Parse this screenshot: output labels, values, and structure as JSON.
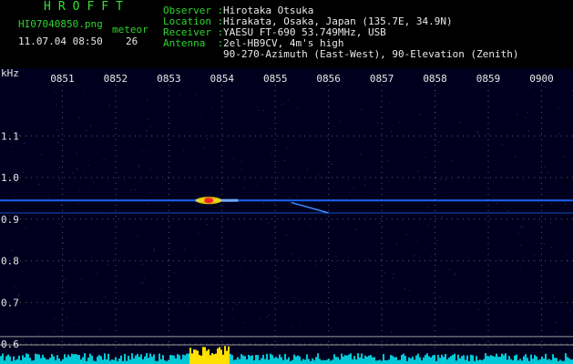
{
  "header": {
    "logo": "HROFFT",
    "filename": "HI07040850.png",
    "datetime": "11.07.04 08:50",
    "meteor_label": "meteor",
    "meteor_count": "26",
    "info_labels": [
      "Observer :",
      "Location :",
      "Receiver :",
      "Antenna  :"
    ],
    "info_values": [
      "Hirotaka Otsuka",
      "Hirakata, Osaka, Japan (135.7E, 34.9N)",
      "YAESU FT-690 53.749MHz, USB",
      "2el-HB9CV, 4m's high"
    ],
    "antenna_line2": "90-270-Azimuth (East-West), 90-Elevation (Zenith)"
  },
  "colors": {
    "background": "#000010",
    "plot_bg": "#00001e",
    "text_green": "#2fd52f",
    "grid_line": "#5a5a5a",
    "signal": "#1a6bff",
    "signal_hot": "#ff2020",
    "signal_warm": "#ffe000",
    "noise_base": "#00c8d8",
    "noise_peak": "#ffe000"
  },
  "chart_data": {
    "type": "heatmap",
    "xlabel": "",
    "ylabel": "kHz",
    "x_ticks": [
      "0851",
      "0852",
      "0853",
      "0854",
      "0855",
      "0856",
      "0857",
      "0858",
      "0859",
      "0900"
    ],
    "x_tick_minutes": [
      1,
      2,
      3,
      4,
      5,
      6,
      7,
      8,
      9,
      10
    ],
    "x_range_minutes": [
      0,
      10.3
    ],
    "y_ticks": [
      "1.1",
      "1.0",
      "0.9",
      "0.8",
      "0.7",
      "0.6"
    ],
    "y_tick_values": [
      1.1,
      1.0,
      0.9,
      0.8,
      0.7,
      0.6
    ],
    "ylim": [
      0.585,
      1.175
    ],
    "carriers_khz": [
      0.945,
      0.915
    ],
    "meteor_events": [
      {
        "start_min": 3.5,
        "end_min": 4.3,
        "khz": 0.945,
        "peak_min": 3.75
      },
      {
        "start_min": 5.3,
        "end_min": 6.0,
        "khz_start": 0.94,
        "khz_end": 0.915
      }
    ],
    "reference_lines_khz": [
      0.618,
      0.598
    ],
    "grid": "dotted",
    "legend": "none"
  }
}
